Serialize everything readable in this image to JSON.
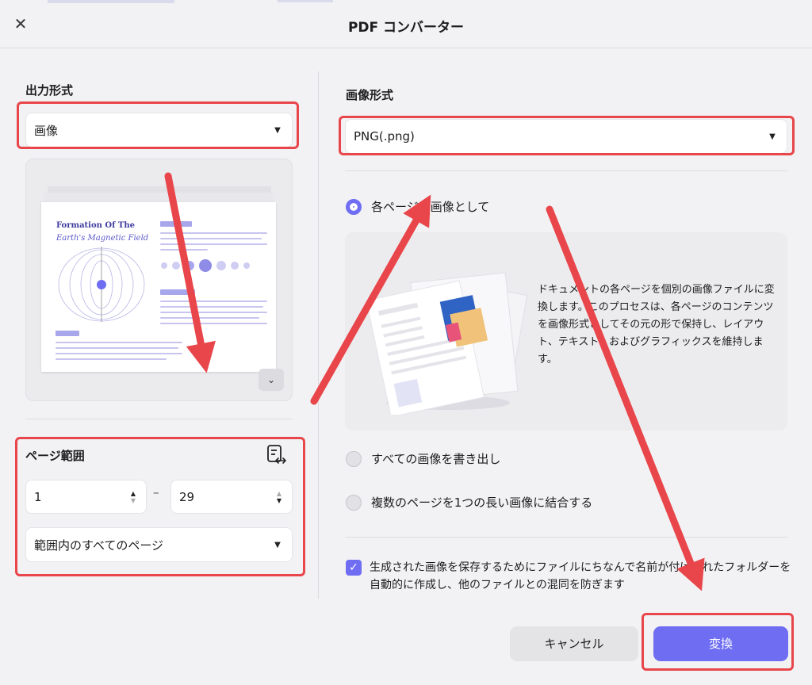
{
  "window": {
    "title": "PDF コンバーター",
    "close_icon": "close-icon"
  },
  "output_format": {
    "label": "出力形式",
    "selected": "画像"
  },
  "preview": {
    "title_line1": "Formation Of The",
    "title_line2": "Earth's Magnetic Field"
  },
  "page_range": {
    "label": "ページ範囲",
    "from": "1",
    "to": "29",
    "separator": "–",
    "scope": "範囲内のすべてのページ"
  },
  "image_format": {
    "label": "画像形式",
    "selected": "PNG(.png)"
  },
  "options": {
    "each_page": "各ページを画像として",
    "export_all_images": "すべての画像を書き出し",
    "combine_pages": "複数のページを1つの長い画像に結合する",
    "selected": "each_page"
  },
  "description": "ドキュメントの各ページを個別の画像ファイルに変換します。このプロセスは、各ページのコンテンツを画像形式としてその元の形で保持し、レイアウト、テキスト、およびグラフィックスを維持します。",
  "create_folder": {
    "checked": true,
    "label": "生成された画像を保存するためにファイルにちなんで名前が付けられたフォルダーを自動的に作成し、他のファイルとの混同を防ぎます"
  },
  "buttons": {
    "cancel": "キャンセル",
    "convert": "変換"
  },
  "colors": {
    "accent": "#6f6ef3",
    "annotation_red": "#e8464a"
  }
}
